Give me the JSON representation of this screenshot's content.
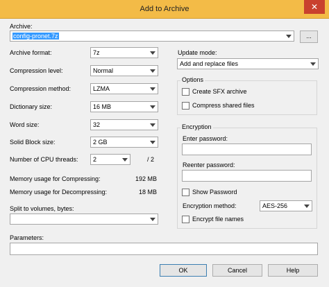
{
  "window": {
    "title": "Add to Archive",
    "close_glyph": "✕"
  },
  "archive": {
    "label": "Archive:",
    "value": "config-pronet.7z",
    "browse_label": "..."
  },
  "left": {
    "archive_format": {
      "label": "Archive format:",
      "value": "7z"
    },
    "compression_level": {
      "label": "Compression level:",
      "value": "Normal"
    },
    "compression_method": {
      "label": "Compression method:",
      "value": "LZMA"
    },
    "dictionary_size": {
      "label": "Dictionary size:",
      "value": "16 MB"
    },
    "word_size": {
      "label": "Word size:",
      "value": "32"
    },
    "solid_block_size": {
      "label": "Solid Block size:",
      "value": "2 GB"
    },
    "cpu_threads": {
      "label": "Number of CPU threads:",
      "value": "2",
      "max": "/ 2"
    },
    "memory_compress": {
      "label": "Memory usage for Compressing:",
      "value": "192 MB"
    },
    "memory_decompress": {
      "label": "Memory usage for Decompressing:",
      "value": "18 MB"
    },
    "split": {
      "label": "Split to volumes, bytes:",
      "value": ""
    }
  },
  "right": {
    "update_mode": {
      "label": "Update mode:",
      "value": "Add and replace files"
    },
    "options": {
      "title": "Options",
      "create_sfx": "Create SFX archive",
      "compress_shared": "Compress shared files"
    },
    "encryption": {
      "title": "Encryption",
      "enter_password": "Enter password:",
      "reenter_password": "Reenter password:",
      "show_password": "Show Password",
      "method_label": "Encryption method:",
      "method_value": "AES-256",
      "encrypt_names": "Encrypt file names"
    }
  },
  "parameters": {
    "label": "Parameters:",
    "value": ""
  },
  "buttons": {
    "ok": "OK",
    "cancel": "Cancel",
    "help": "Help"
  }
}
